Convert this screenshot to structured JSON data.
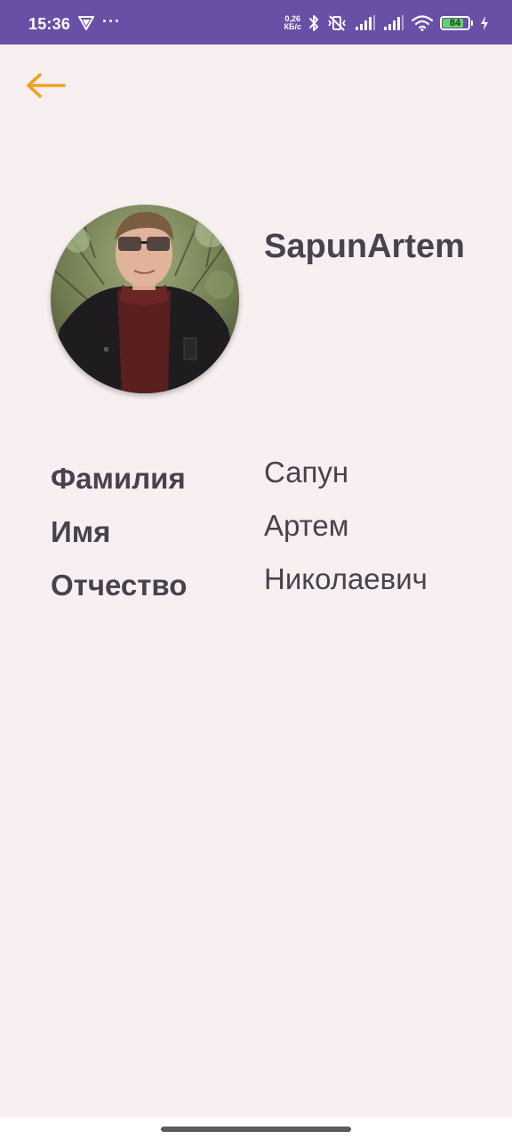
{
  "status_bar": {
    "time": "15:36",
    "dots": "···",
    "net_speed_value": "0,26",
    "net_speed_unit": "КБ/с",
    "battery_level": "84",
    "battery_fraction": 0.84,
    "background_color": "#6a4fa6",
    "icons": [
      "vpn-icon",
      "bluetooth-icon",
      "muted-vibrate-icon",
      "signal-icon",
      "signal-icon",
      "wifi-icon",
      "battery-icon",
      "charging-icon"
    ]
  },
  "toolbar": {
    "back_icon": "arrow-left-icon",
    "back_color": "#f0a020"
  },
  "profile": {
    "username": "SapunArtem",
    "fields": [
      {
        "label": "Фамилия",
        "value": "Сапун"
      },
      {
        "label": "Имя",
        "value": "Артем"
      },
      {
        "label": "Отчество",
        "value": "Николаевич"
      }
    ]
  },
  "colors": {
    "background": "#f7eff0",
    "text": "#48424e"
  }
}
